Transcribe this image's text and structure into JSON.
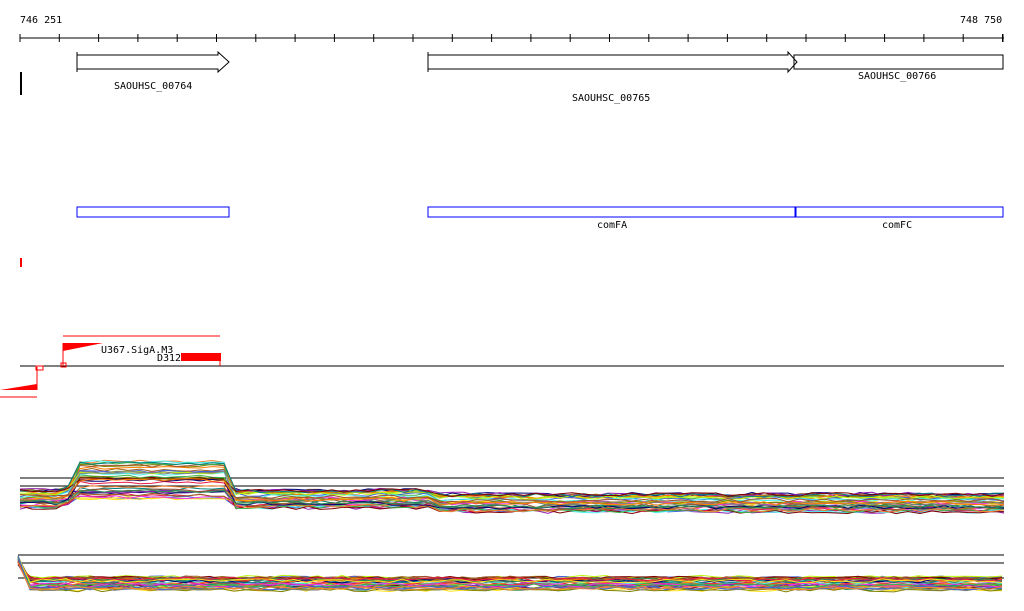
{
  "ruler": {
    "start": "746 251",
    "end": "748 750"
  },
  "genes": [
    {
      "label": "SAOUHSC_00764",
      "strand": "+"
    },
    {
      "label": "SAOUHSC_00765",
      "strand": "+"
    },
    {
      "label": "SAOUHSC_00766",
      "strand": "+"
    }
  ],
  "cds": [
    {
      "label": ""
    },
    {
      "label": "comFA"
    },
    {
      "label": "comFC"
    }
  ],
  "features": {
    "promoter": "U367.SigA.M3",
    "terminator": "D312"
  },
  "colors": {
    "gene": "#000000",
    "cds": "#0000ff",
    "feature": "#ff0000"
  }
}
